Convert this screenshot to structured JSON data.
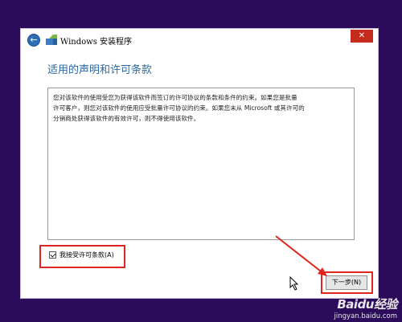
{
  "window": {
    "title": "Windows 安装程序",
    "close_label": "✕"
  },
  "heading": "适用的声明和许可条款",
  "license_text": "您对该软件的使用受您为获得该软件而签订的许可协议的条款和条件的约束。如果您是批量\n许可客户，则您对该软件的使用应受批量许可协议的约束。如果您未从 Microsoft 或其许可的\n分销商处获得该软件的有效许可，则不得使用该软件。",
  "accept": {
    "label": "我接受许可条款(A)",
    "checked": true
  },
  "next_button": {
    "label": "下一步(N)"
  },
  "annotation_color": "#e0241f",
  "watermark": {
    "logo": "Baidu经验",
    "url": "jingyan.baidu.com"
  }
}
